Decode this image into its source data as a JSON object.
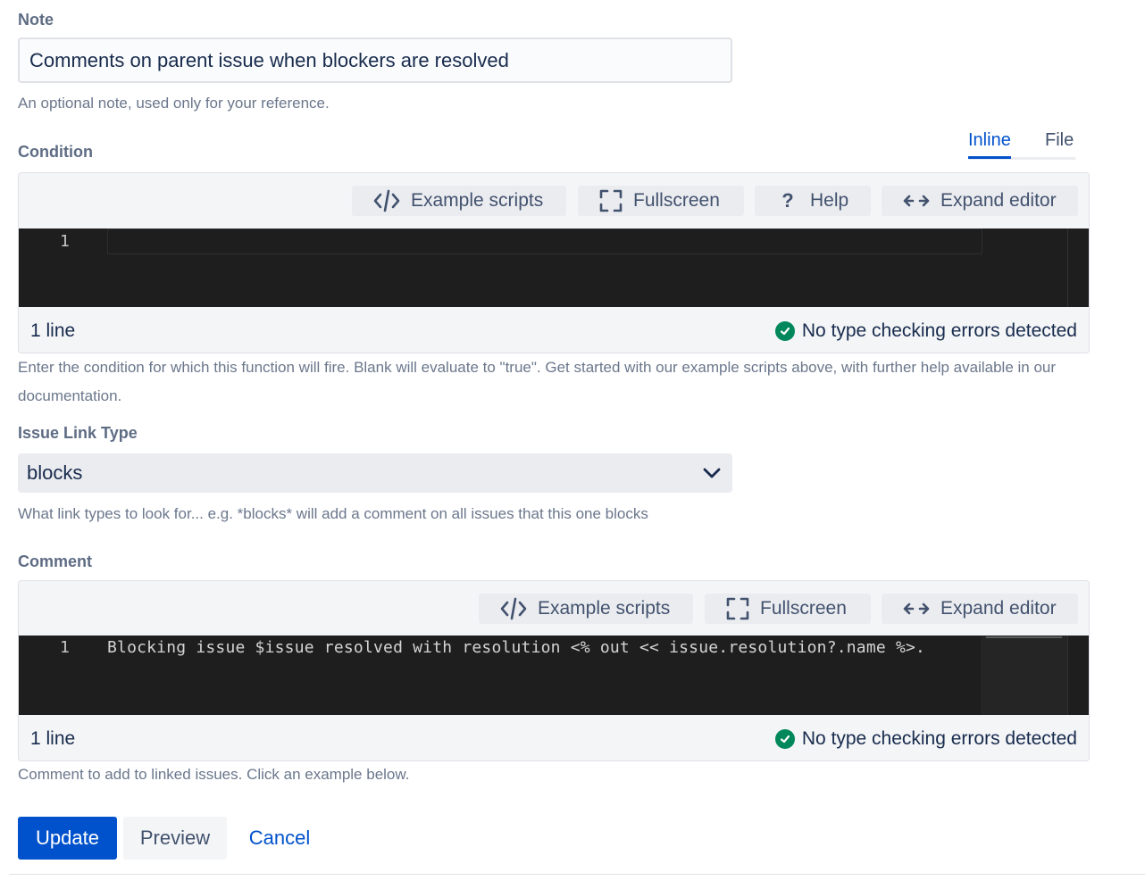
{
  "note": {
    "label": "Note",
    "value": "Comments on parent issue when blockers are resolved",
    "help": "An optional note, used only for your reference."
  },
  "condition": {
    "label": "Condition",
    "tabs": [
      "Inline",
      "File"
    ],
    "active_tab": "Inline",
    "toolbar": {
      "example_scripts": "Example scripts",
      "fullscreen": "Fullscreen",
      "help": "Help",
      "expand_editor": "Expand editor"
    },
    "line_number": "1",
    "code": "",
    "line_count": "1 line",
    "status": "No type checking errors detected",
    "help": "Enter the condition for which this function will fire. Blank will evaluate to \"true\". Get started with our example scripts above, with further help available in our documentation."
  },
  "link_type": {
    "label": "Issue Link Type",
    "selected": "blocks",
    "help": "What link types to look for... e.g. *blocks* will add a comment on all issues that this one blocks"
  },
  "comment": {
    "label": "Comment",
    "toolbar": {
      "example_scripts": "Example scripts",
      "fullscreen": "Fullscreen",
      "expand_editor": "Expand editor"
    },
    "line_number": "1",
    "code": "Blocking issue $issue resolved with resolution <% out << issue.resolution?.name %>.",
    "line_count": "1 line",
    "status": "No type checking errors detected",
    "help": "Comment to add to linked issues. Click an example below."
  },
  "actions": {
    "update": "Update",
    "preview": "Preview",
    "cancel": "Cancel"
  },
  "colors": {
    "primary": "#0052cc",
    "success": "#00875a",
    "editor_bg": "#1e1e1e"
  }
}
